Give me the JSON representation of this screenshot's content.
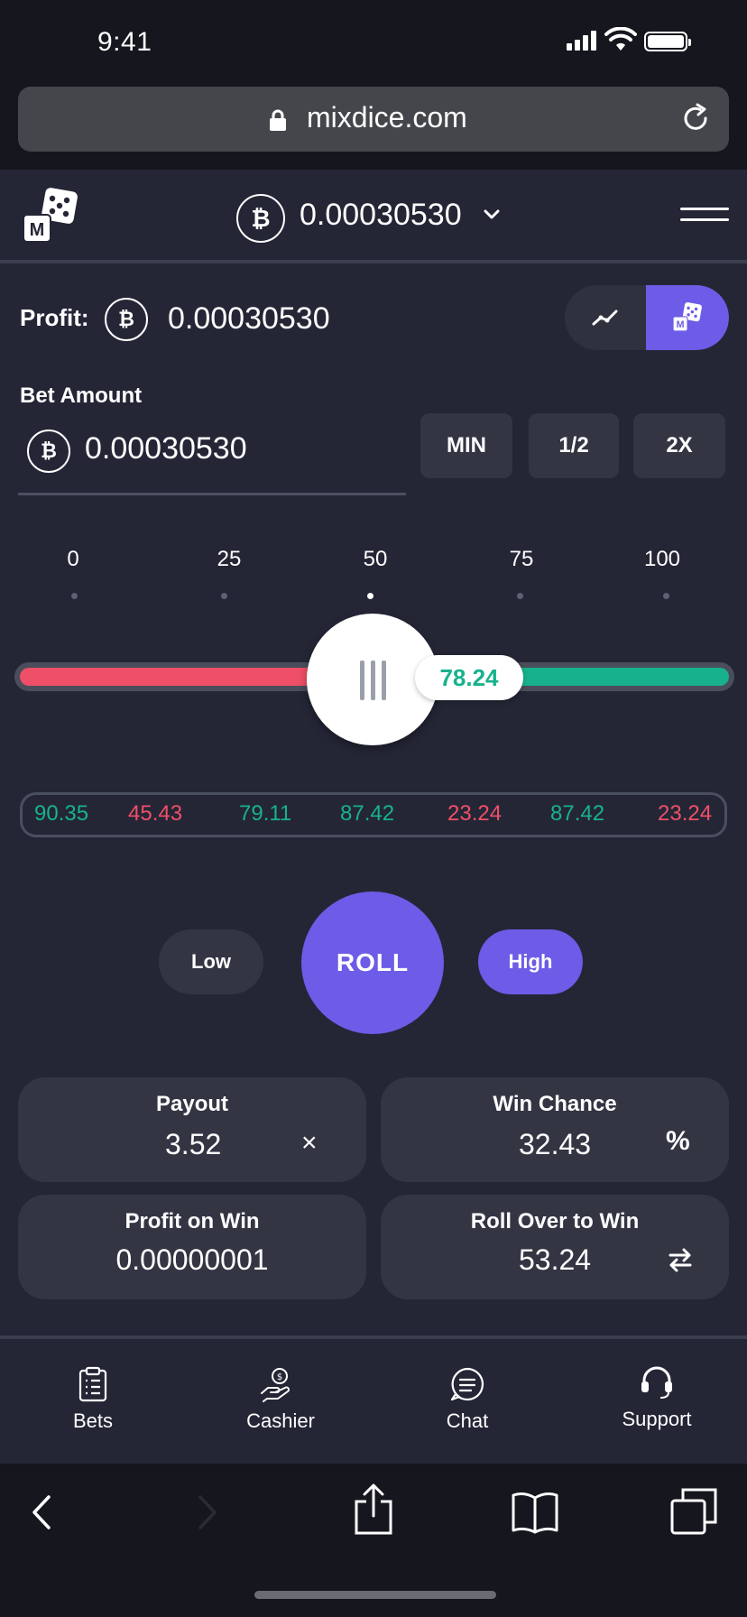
{
  "status": {
    "time": "9:41"
  },
  "browser": {
    "url": "mixdice.com"
  },
  "header": {
    "balance": "0.00030530",
    "currency_symbol": "₿"
  },
  "profit": {
    "label": "Profit:",
    "value": "0.00030530"
  },
  "bet": {
    "label": "Bet Amount",
    "amount": "0.00030530",
    "quick_buttons": [
      "MIN",
      "1/2",
      "2X"
    ]
  },
  "slider": {
    "scale": [
      "0",
      "25",
      "50",
      "75",
      "100"
    ],
    "value": "78.24",
    "low_color": "#ef4f68",
    "high_color": "#17b28c"
  },
  "history": [
    {
      "value": "90.35",
      "color": "#17b28c"
    },
    {
      "value": "45.43",
      "color": "#ef4f68"
    },
    {
      "value": "79.11",
      "color": "#17b28c"
    },
    {
      "value": "87.42",
      "color": "#17b28c"
    },
    {
      "value": "23.24",
      "color": "#ef4f68"
    },
    {
      "value": "87.42",
      "color": "#17b28c"
    },
    {
      "value": "23.24",
      "color": "#ef4f68"
    }
  ],
  "controls": {
    "low": "Low",
    "roll": "ROLL",
    "high": "High",
    "accent": "#6c5ce7"
  },
  "cards": {
    "payout": {
      "title": "Payout",
      "value": "3.52",
      "suffix": "×"
    },
    "win_chance": {
      "title": "Win Chance",
      "value": "32.43",
      "suffix": "%"
    },
    "profit_on_win": {
      "title": "Profit on Win",
      "value": "0.00000001"
    },
    "roll_over": {
      "title": "Roll Over to Win",
      "value": "53.24",
      "icon": "swap-icon"
    }
  },
  "nav": {
    "bets": "Bets",
    "cashier": "Cashier",
    "chat": "Chat",
    "support": "Support"
  }
}
